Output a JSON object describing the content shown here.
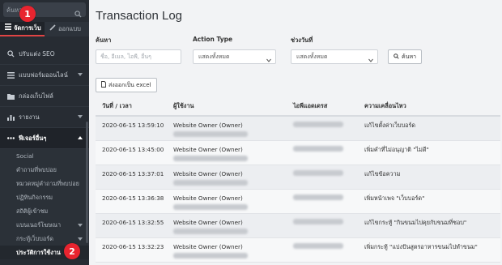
{
  "sidebar": {
    "search_placeholder": "ค้นหา...",
    "tabs": [
      {
        "label": "จัดการเว็บ",
        "icon": "list-icon"
      },
      {
        "label": "ออกแบบ",
        "icon": "brush-icon"
      }
    ],
    "items": [
      {
        "label": "ปรับแต่ง SEO",
        "icon": "search-icon"
      },
      {
        "label": "แบบฟอร์มออนไลน์",
        "icon": "list-icon"
      },
      {
        "label": "กล่องเก็บไฟล์",
        "icon": "folder-icon"
      },
      {
        "label": "รายงาน",
        "icon": "chart-icon"
      },
      {
        "label": "ฟีเจอร์อื่นๆ",
        "icon": "more-icon"
      }
    ],
    "subitems": [
      {
        "label": "Social"
      },
      {
        "label": "คำถามที่พบบ่อย"
      },
      {
        "label": "หมวดหมู่คำถามที่พบบ่อย"
      },
      {
        "label": "ปฏิทินกิจกรรม"
      },
      {
        "label": "สถิติผู้เข้าชม"
      },
      {
        "label": "แบนเนอร์โฆษณา"
      },
      {
        "label": "กระทู้เว็บบอร์ด"
      },
      {
        "label": "ประวัติการใช้งาน"
      }
    ],
    "badges": [
      "1",
      "2"
    ]
  },
  "main": {
    "title": "Transaction Log",
    "filters": {
      "search_label": "ค้นหา",
      "search_placeholder": "ชื่อ, อีเมล, ไอพี, อื่นๆ",
      "action_label": "Action Type",
      "action_value": "แสดงทั้งหมด",
      "range_label": "ช่วงวันที่",
      "range_value": "แสดงทั้งหมด",
      "search_button": "ค้นหา",
      "export_button": "ส่งออกเป็น excel"
    },
    "table": {
      "headers": [
        "วันที่ / เวลา",
        "ผู้ใช้งาน",
        "ไอพีแอดเดรส",
        "ความเคลื่อนไหว"
      ],
      "rows": [
        {
          "datetime": "2020-06-15 13:59:10",
          "user": "Website Owner (Owner)",
          "action": "แก้ไขตั้งค่าเว็บบอร์ด"
        },
        {
          "datetime": "2020-06-15 13:45:00",
          "user": "Website Owner (Owner)",
          "action": "เพิ่มคำที่ไม่อนุญาติ \"ไม่ดี\""
        },
        {
          "datetime": "2020-06-15 13:37:01",
          "user": "Website Owner (Owner)",
          "action": "แก้ไขข้อความ"
        },
        {
          "datetime": "2020-06-15 13:36:38",
          "user": "Website Owner (Owner)",
          "action": "เพิ่มหน้าเพจ \"เว็บบอร์ด\""
        },
        {
          "datetime": "2020-06-15 13:32:55",
          "user": "Website Owner (Owner)",
          "action": "แก้ไขกระทู้ \"กินขนมไปคุยกับขนมที่ชอบ\""
        },
        {
          "datetime": "2020-06-15 13:32:23",
          "user": "Website Owner (Owner)",
          "action": "เพิ่มกระทู้ \"แบ่งปันสูตรอาหารขนมไปทำขนม\""
        }
      ]
    }
  },
  "colors": {
    "sidebar_bg": "#272c33",
    "accent": "#e04444",
    "badge": "#e8242f",
    "main_bg": "#f2f3f5"
  }
}
